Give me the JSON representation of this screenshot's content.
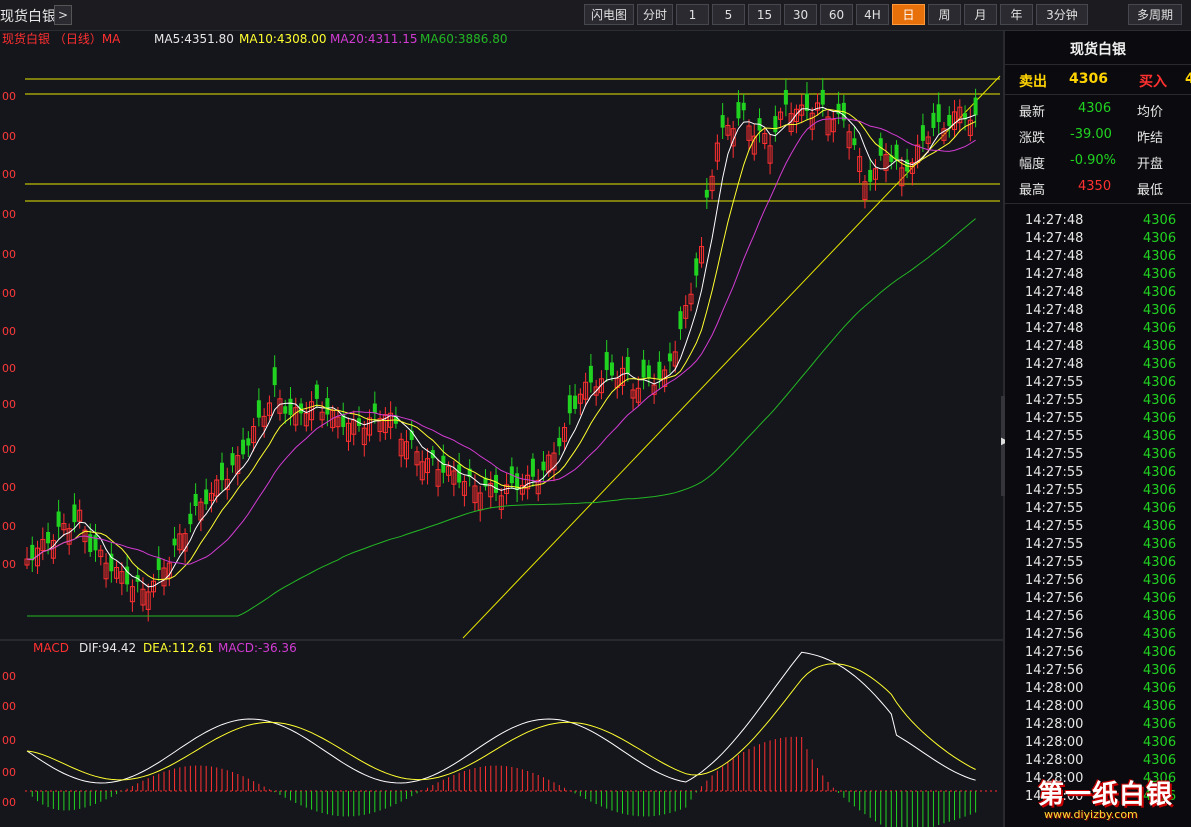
{
  "toolbar": {
    "symbol": "现货白银",
    "expand": ">",
    "tabs": [
      "闪电图",
      "分时",
      "1",
      "5",
      "15",
      "30",
      "60",
      "4H",
      "日",
      "周",
      "月",
      "年",
      "3分钟"
    ],
    "active_tab": "日",
    "multi_period": "多周期"
  },
  "main_legend": {
    "title": "现货白银 （日线）MA",
    "ma5": "MA5:4351.80",
    "ma10": "MA10:4308.00",
    "ma20": "MA20:4311.15",
    "ma60": "MA60:3886.80"
  },
  "macd_legend": {
    "title": "MACD",
    "dif": "DIF:94.42",
    "dea": "DEA:112.61",
    "macd": "MACD:-36.36"
  },
  "y_labels_main": [
    "00",
    "00",
    "00",
    "00",
    "00",
    "00",
    "00",
    "00",
    "00",
    "00",
    "00",
    "00",
    "00"
  ],
  "y_labels_macd": [
    "00",
    "00",
    "00",
    "00",
    "00"
  ],
  "panel": {
    "title": "现货白银",
    "sell_label": "卖出",
    "sell_value": "4306",
    "buy_label": "买入",
    "buy_value": "4",
    "rows": [
      {
        "l1": "最新",
        "v1": "4306",
        "l2": "均价"
      },
      {
        "l1": "涨跌",
        "v1": "-39.00",
        "l2": "昨结"
      },
      {
        "l1": "幅度",
        "v1": "-0.90%",
        "l2": "开盘"
      },
      {
        "l1": "最高",
        "v1": "4350",
        "l2": "最低"
      }
    ],
    "ticks": [
      {
        "time": "14:27:48",
        "price": "4306"
      },
      {
        "time": "14:27:48",
        "price": "4306"
      },
      {
        "time": "14:27:48",
        "price": "4306"
      },
      {
        "time": "14:27:48",
        "price": "4306"
      },
      {
        "time": "14:27:48",
        "price": "4306"
      },
      {
        "time": "14:27:48",
        "price": "4306"
      },
      {
        "time": "14:27:48",
        "price": "4306"
      },
      {
        "time": "14:27:48",
        "price": "4306"
      },
      {
        "time": "14:27:48",
        "price": "4306"
      },
      {
        "time": "14:27:55",
        "price": "4306"
      },
      {
        "time": "14:27:55",
        "price": "4306"
      },
      {
        "time": "14:27:55",
        "price": "4306"
      },
      {
        "time": "14:27:55",
        "price": "4306"
      },
      {
        "time": "14:27:55",
        "price": "4306"
      },
      {
        "time": "14:27:55",
        "price": "4306"
      },
      {
        "time": "14:27:55",
        "price": "4306"
      },
      {
        "time": "14:27:55",
        "price": "4306"
      },
      {
        "time": "14:27:55",
        "price": "4306"
      },
      {
        "time": "14:27:55",
        "price": "4306"
      },
      {
        "time": "14:27:55",
        "price": "4306"
      },
      {
        "time": "14:27:56",
        "price": "4306"
      },
      {
        "time": "14:27:56",
        "price": "4306"
      },
      {
        "time": "14:27:56",
        "price": "4306"
      },
      {
        "time": "14:27:56",
        "price": "4306"
      },
      {
        "time": "14:27:56",
        "price": "4306"
      },
      {
        "time": "14:27:56",
        "price": "4306"
      },
      {
        "time": "14:28:00",
        "price": "4306"
      },
      {
        "time": "14:28:00",
        "price": "4306"
      },
      {
        "time": "14:28:00",
        "price": "4306"
      },
      {
        "time": "14:28:00",
        "price": "4306"
      },
      {
        "time": "14:28:00",
        "price": "4306"
      },
      {
        "time": "14:28:00",
        "price": "4306"
      },
      {
        "time": "14:28:00",
        "price": "4306"
      }
    ]
  },
  "watermark": {
    "text": "第一纸白银",
    "url": "www.diyizby.com"
  },
  "colors": {
    "up": "#ff3030",
    "down": "#21d321",
    "ma5": "#ffffff",
    "ma10": "#ffff30",
    "ma20": "#d23cd2",
    "ma60": "#23b823",
    "hline": "#e6e600",
    "active_tab": "#e8700b"
  },
  "chart_data": {
    "type": "candlestick",
    "period": "日",
    "candle_shape": [
      1,
      -1,
      1,
      1,
      -1,
      1,
      -1,
      1,
      1,
      -1,
      1,
      1,
      -1,
      -1,
      1,
      1,
      -1,
      1,
      1,
      -1,
      1,
      -1,
      1,
      1,
      1,
      -1,
      1,
      1,
      -1,
      1,
      1,
      -1,
      -1,
      1,
      -1,
      1,
      1,
      -1,
      1,
      -1,
      1,
      -1,
      -1,
      1,
      -1,
      1,
      1,
      -1,
      1,
      -1,
      -1,
      1,
      -1,
      1,
      1,
      -1,
      1,
      -1,
      1,
      1,
      -1,
      1,
      1,
      -1,
      1,
      1,
      -1,
      1,
      1,
      1,
      -1,
      1,
      1,
      -1,
      1,
      1,
      1,
      -1,
      1,
      -1,
      1,
      1,
      -1,
      1,
      -1,
      1,
      1,
      -1,
      1,
      -1,
      1,
      1,
      -1,
      -1,
      1,
      1,
      -1,
      1,
      -1,
      1,
      1,
      -1,
      1,
      -1,
      -1,
      1,
      1,
      -1,
      1,
      1,
      -1,
      -1,
      1,
      1,
      -1,
      1,
      1,
      -1,
      -1,
      1,
      -1,
      1,
      -1
    ]
  }
}
